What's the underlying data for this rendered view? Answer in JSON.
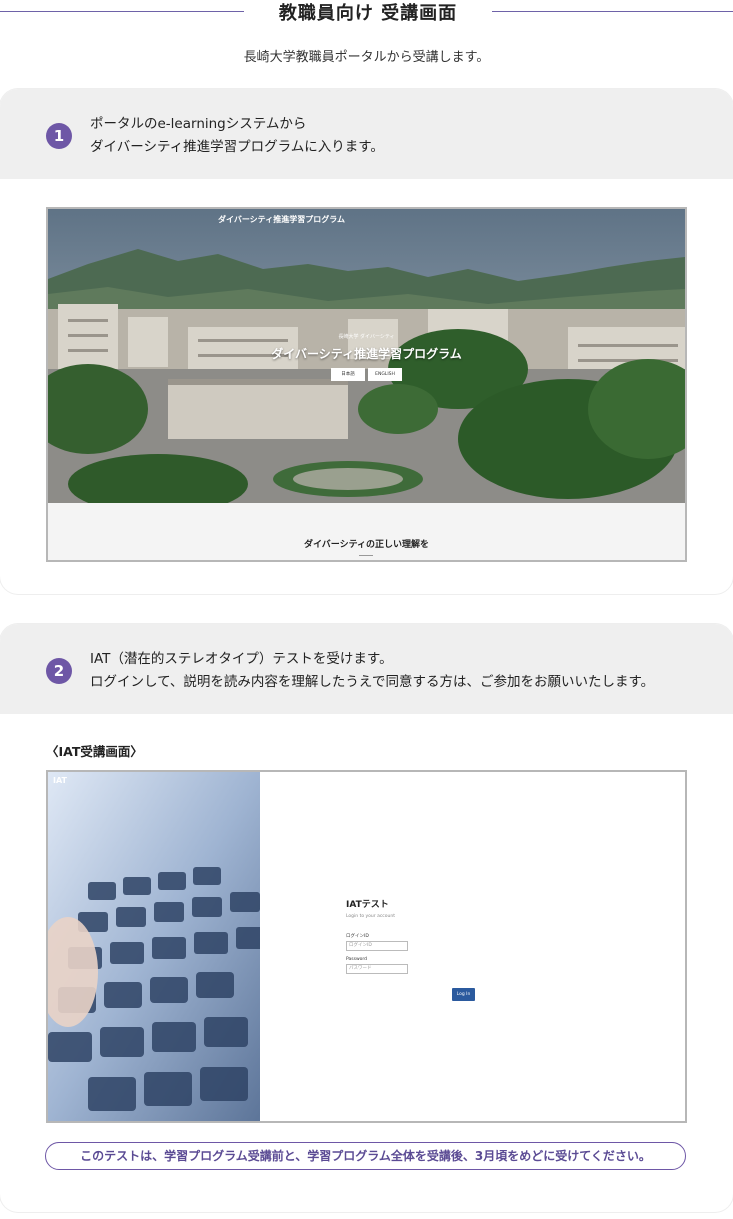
{
  "header": {
    "title": "教職員向け 受講画面"
  },
  "intro": "長崎大学教職員ポータルから受講します。",
  "step1": {
    "number": "1",
    "line1": "ポータルのe-learningシステムから",
    "line2": "ダイバーシティ推進学習プログラムに入ります。"
  },
  "portal_shot": {
    "top_title": "ダイバーシティ推進学習プログラム",
    "subtitle": "長崎大学 ダイバーシティ",
    "main_title": "ダイバーシティ推進学習プログラム",
    "btn_ja": "日本語",
    "btn_en": "ENGLISH",
    "section_title": "ダイバーシティの正しい理解を"
  },
  "step2": {
    "number": "2",
    "line1": "IAT（潜在的ステレオタイプ）テストを受けます。",
    "line2": "ログインして、説明を読み内容を理解したうえで同意する方は、ご参加をお願いいたします。"
  },
  "iat_label": "〈IAT受講画面〉",
  "iat_shot": {
    "logo": "IAT",
    "form_title": "IATテスト",
    "form_sub": "Login to your account",
    "login_id_label": "ログインID",
    "login_id_placeholder": "ログインID",
    "password_label": "Password",
    "password_placeholder": "パスワード",
    "login_button": "Log In"
  },
  "note": "このテストは、学習プログラム受講前と、学習プログラム全体を受講後、3月頃をめどに受けてください。",
  "colors": {
    "accent": "#6e57a6",
    "button": "#2b5a9e"
  }
}
